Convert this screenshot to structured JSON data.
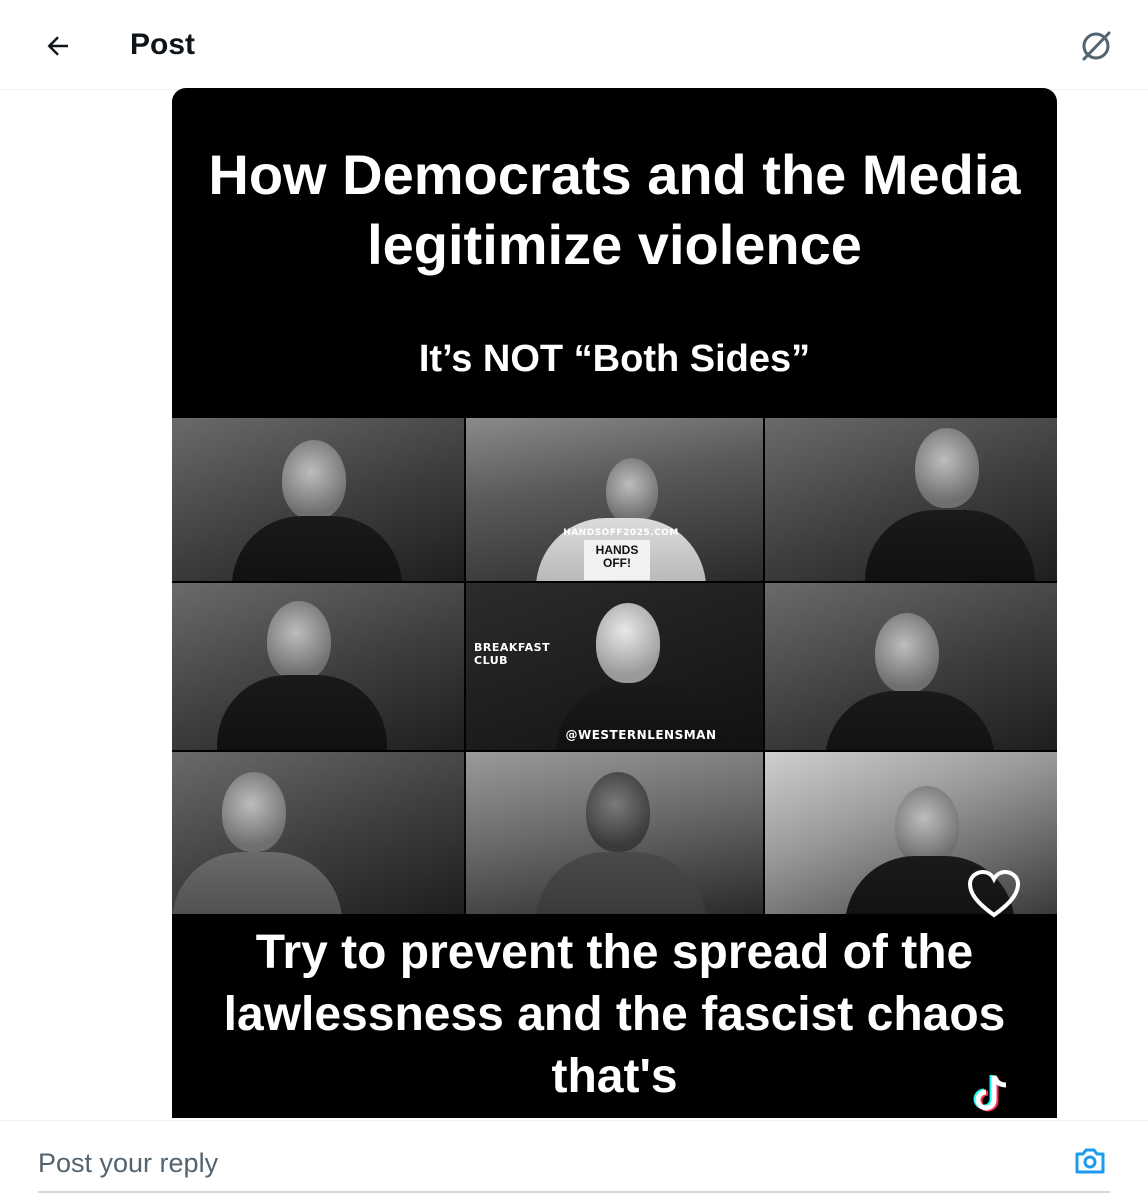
{
  "header": {
    "title": "Post",
    "back_icon": "arrow-left-icon",
    "grok_icon": "grok-icon"
  },
  "media": {
    "headline": "How Democrats and the Media legitimize violence",
    "subheadline": "It’s NOT “Both Sides”",
    "sign_url": "HANDSOFF2025.COM",
    "sign_text": "HANDS OFF!",
    "club_label": "BREAKFAST CLUB",
    "watermark": "@WESTERNLENSMAN",
    "caption": "Try to prevent the spread of the lawlessness and the fascist chaos that's",
    "heart_icon": "heart-icon",
    "tiktok_icon": "tiktok-icon"
  },
  "reply": {
    "placeholder": "Post your reply",
    "camera_icon": "camera-icon",
    "accent": "#1d9bf0"
  }
}
